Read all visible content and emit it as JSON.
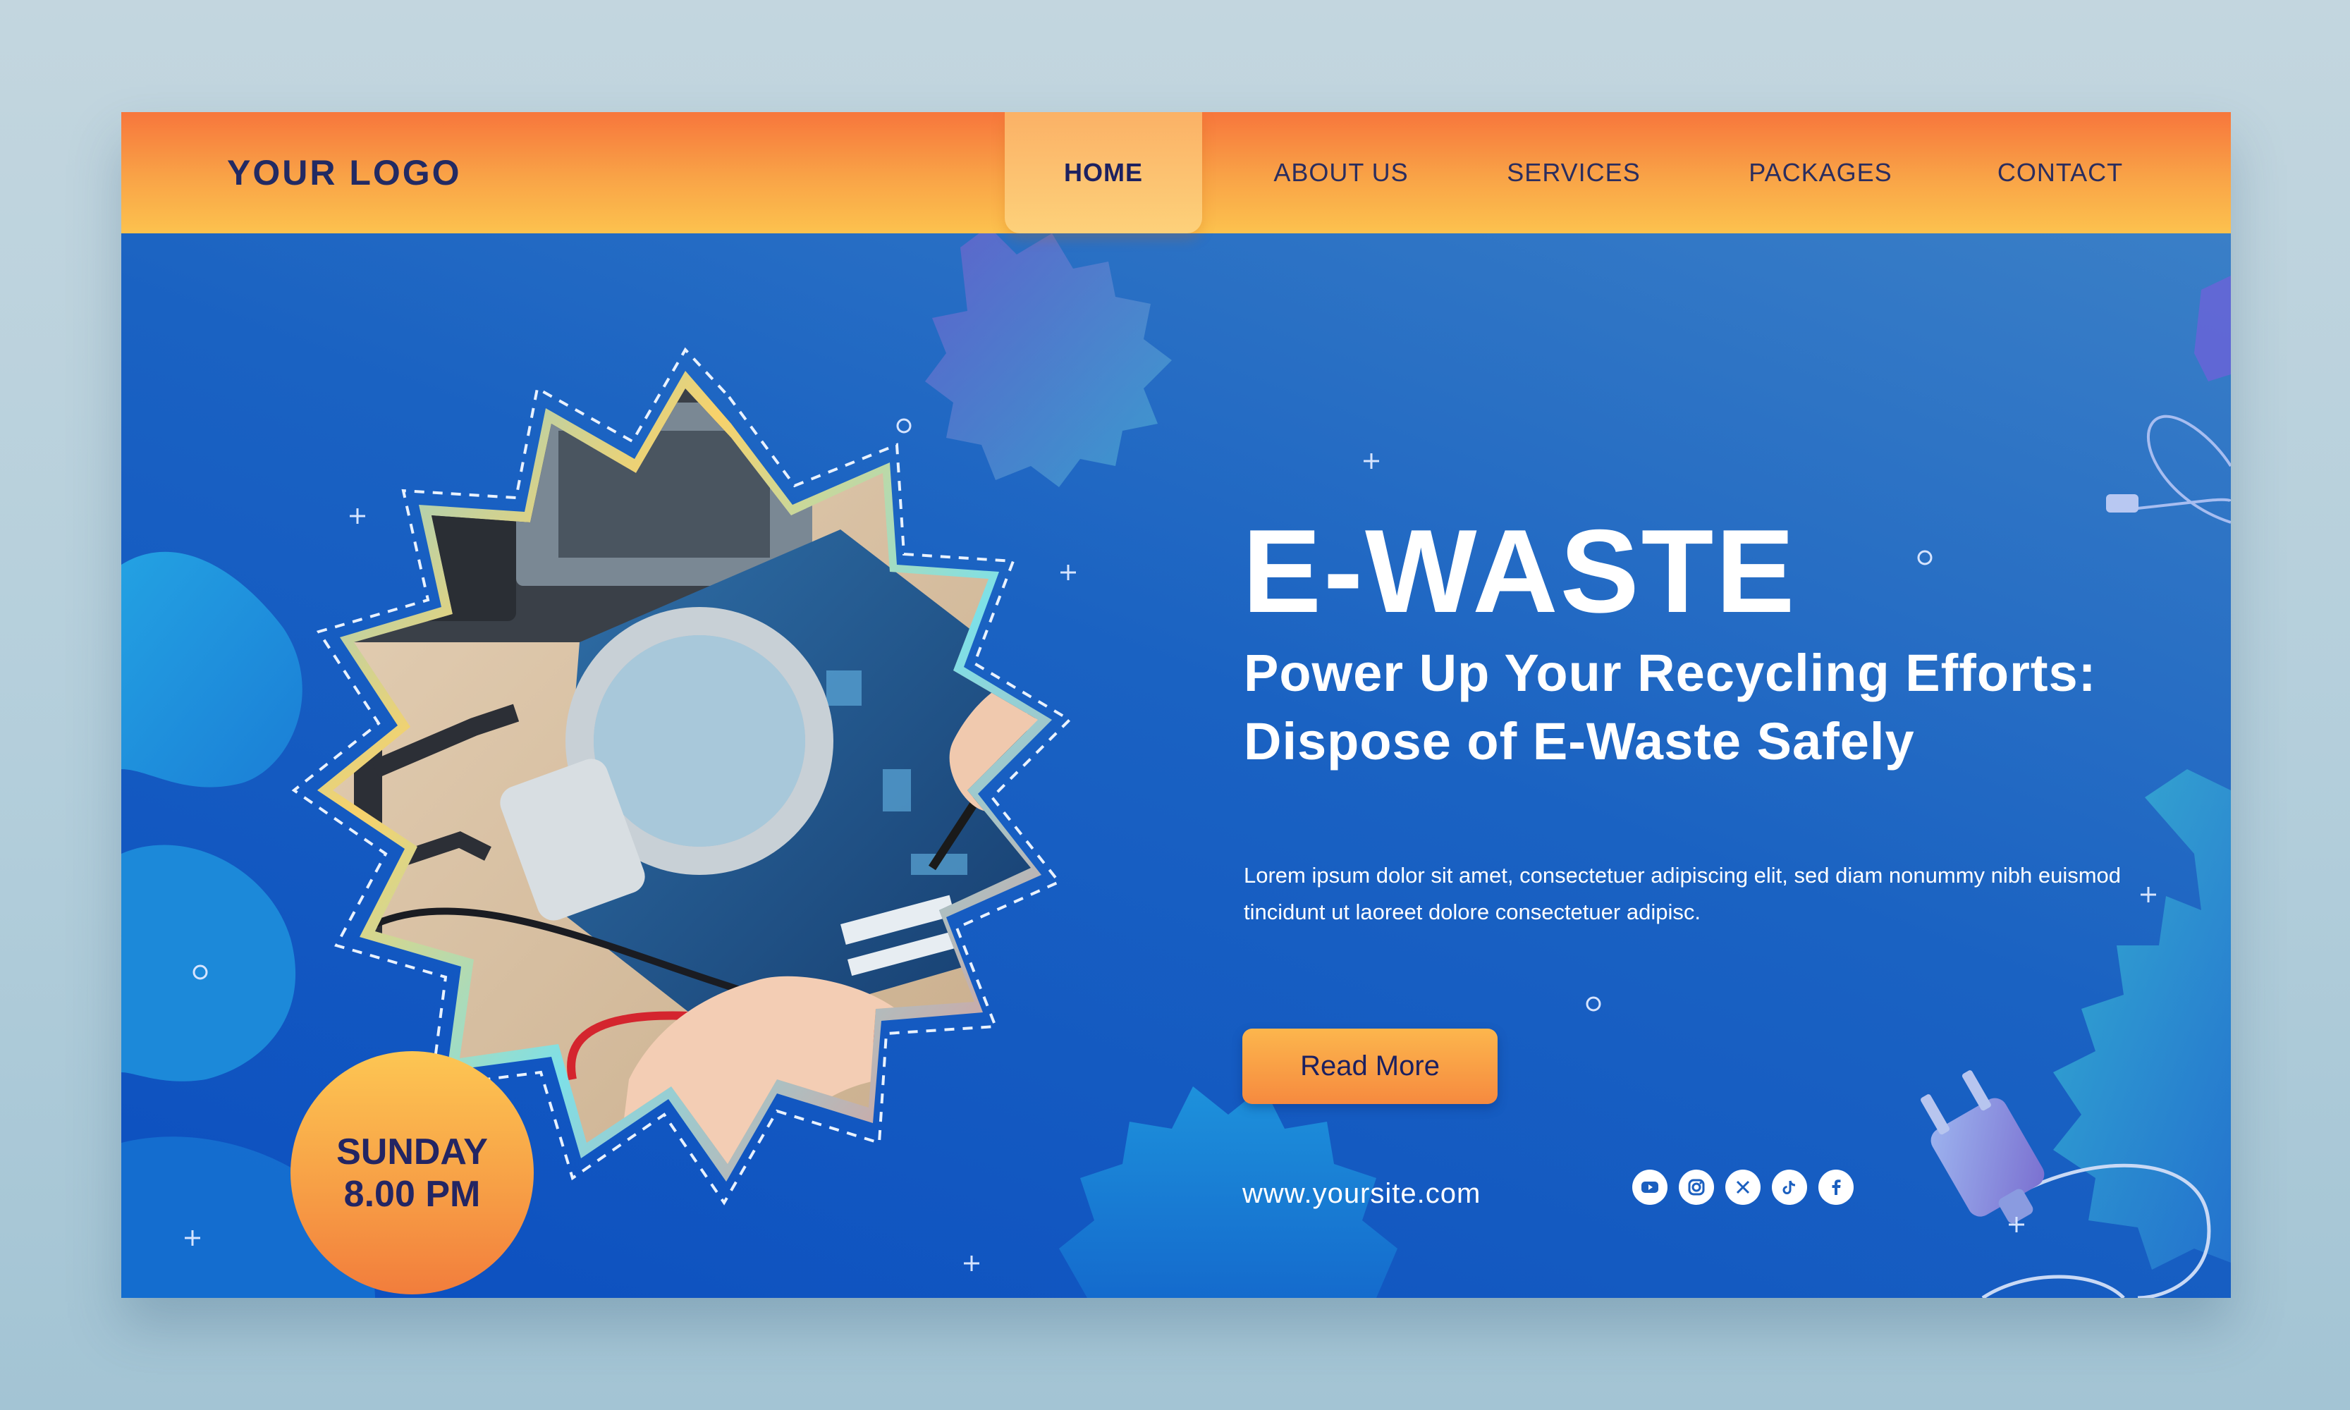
{
  "navbar": {
    "logo": "YOUR LOGO",
    "items": [
      {
        "label": "HOME",
        "active": true
      },
      {
        "label": "ABOUT US",
        "active": false
      },
      {
        "label": "SERVICES",
        "active": false
      },
      {
        "label": "PACKAGES",
        "active": false
      },
      {
        "label": "CONTACT",
        "active": false
      }
    ]
  },
  "hero": {
    "title": "E-WASTE",
    "subtitle": "Power Up Your Recycling Efforts: Dispose of E-Waste Safely",
    "description": "Lorem ipsum dolor sit amet, consectetuer adipiscing elit, sed diam nonummy nibh euismod tincidunt ut laoreet dolore consectetuer adipisc.",
    "cta_label": "Read More",
    "website": "www.yoursite.com",
    "socials": [
      "youtube-icon",
      "instagram-icon",
      "x-icon",
      "tiktok-icon",
      "facebook-icon"
    ]
  },
  "badge": {
    "day": "SUNDAY",
    "time": "8.00 PM"
  },
  "image": {
    "subject": "hands-soldering-circuit-board"
  },
  "colors": {
    "nav_top": "#f7763c",
    "nav_bottom": "#fcc24e",
    "hero_blue": "#1a62c2",
    "text_dark": "#222a63",
    "button_orange": "#f68a3f"
  }
}
